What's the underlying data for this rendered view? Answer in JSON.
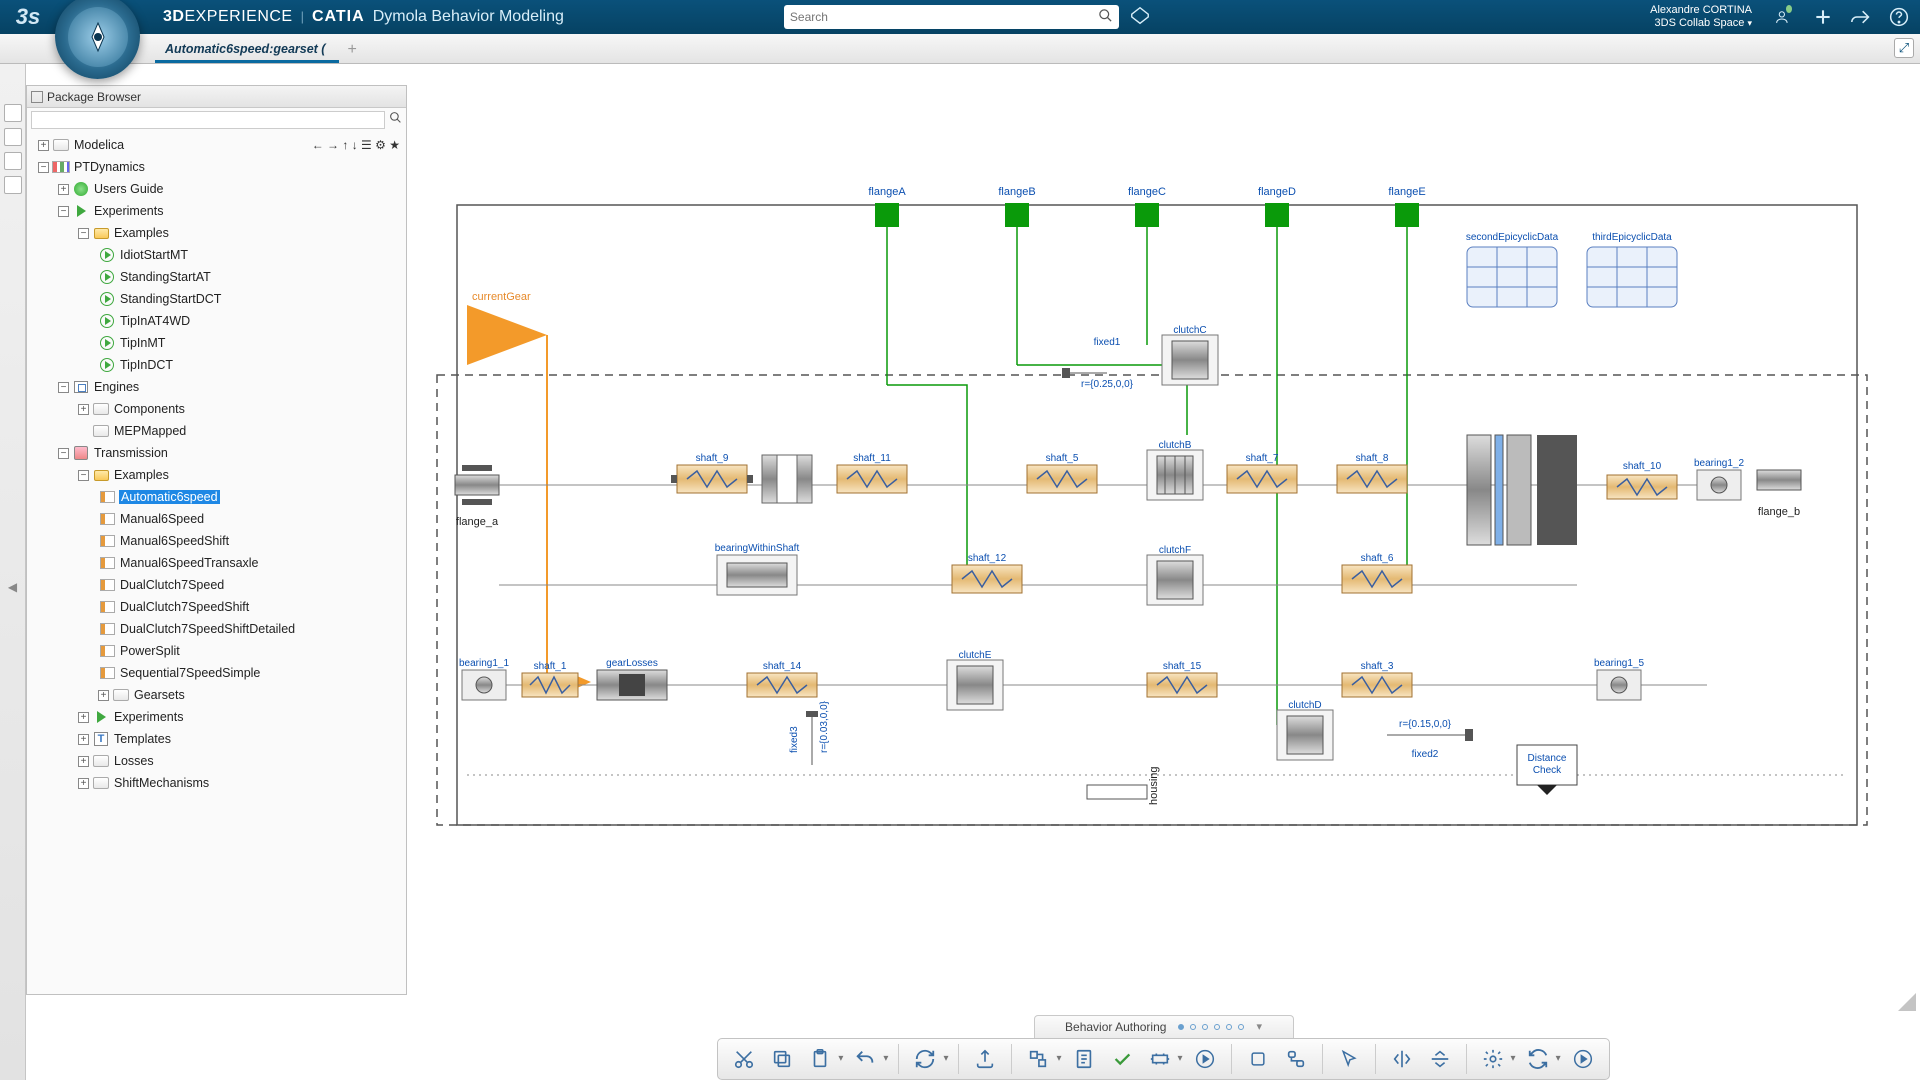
{
  "header": {
    "brand_3d_a": "3D",
    "brand_3d_b": "EXPERIENCE",
    "brand_catia": "CATIA",
    "brand_sub": "Dymola Behavior Modeling",
    "search_placeholder": "Search",
    "user_name": "Alexandre CORTINA",
    "user_space": "3DS Collab Space"
  },
  "tab": {
    "title": "Automatic6speed:gearset ("
  },
  "pkg": {
    "panel_title": "Package Browser",
    "root": {
      "label": "Modelica"
    },
    "ptd": {
      "label": "PTDynamics"
    },
    "ug": {
      "label": "Users Guide"
    },
    "exp": {
      "label": "Experiments"
    },
    "examples": {
      "label": "Examples"
    },
    "e": {
      "idiot": "IdiotStartMT",
      "stand_at": "StandingStartAT",
      "stand_dct": "StandingStartDCT",
      "tip4": "TipInAT4WD",
      "tipmt": "TipInMT",
      "tipdct": "TipInDCT"
    },
    "eng": {
      "label": "Engines"
    },
    "comp": {
      "label": "Components"
    },
    "mep": {
      "label": "MEPMapped"
    },
    "trans": {
      "label": "Transmission"
    },
    "t_examples": {
      "label": "Examples"
    },
    "tx": {
      "auto6": "Automatic6speed",
      "m6": "Manual6Speed",
      "m6s": "Manual6SpeedShift",
      "m6t": "Manual6SpeedTransaxle",
      "dc7": "DualClutch7Speed",
      "dc7s": "DualClutch7SpeedShift",
      "dc7d": "DualClutch7SpeedShiftDetailed",
      "ps": "PowerSplit",
      "seq7": "Sequential7SpeedSimple",
      "gears": "Gearsets"
    },
    "exp2": {
      "label": "Experiments"
    },
    "tpl": {
      "label": "Templates"
    },
    "loss": {
      "label": "Losses"
    },
    "shift": {
      "label": "ShiftMechanisms"
    }
  },
  "diagram": {
    "currentGear": "currentGear",
    "flanges": {
      "a": "flangeA",
      "b": "flangeB",
      "c": "flangeC",
      "d": "flangeD",
      "e": "flangeE"
    },
    "tables": {
      "t1": "secondEpicyclicData",
      "t2": "thirdEpicyclicData"
    },
    "ports": {
      "fa": "flange_a",
      "fb": "flange_b"
    },
    "fixed1": "fixed1",
    "fixed1r": "r={0.25,0,0}",
    "fixed2": "fixed2",
    "fixed2r": "r={0.15,0,0}",
    "fixed3": "fixed3",
    "fixed3r": "r={0.03,0,0}",
    "housing": "housing",
    "distchk": "Distance\nCheck",
    "bear11": "bearing1_1",
    "bear15": "bearing1_5",
    "bear12": "bearing1_2",
    "gl": "gearLosses",
    "bws": "bearingWithinShaft",
    "cl": {
      "b": "clutchB",
      "c": "clutchC",
      "d": "clutchD",
      "e": "clutchE",
      "f": "clutchF"
    },
    "sh": {
      "s1": "shaft_1",
      "s3": "shaft_3",
      "s5": "shaft_5",
      "s6": "shaft_6",
      "s7": "shaft_7",
      "s8": "shaft_8",
      "s9": "shaft_9",
      "s10": "shaft_10",
      "s11": "shaft_11",
      "s12": "shaft_12",
      "s14": "shaft_14",
      "s15": "shaft_15"
    }
  },
  "bottom": {
    "label": "Behavior Authoring"
  }
}
